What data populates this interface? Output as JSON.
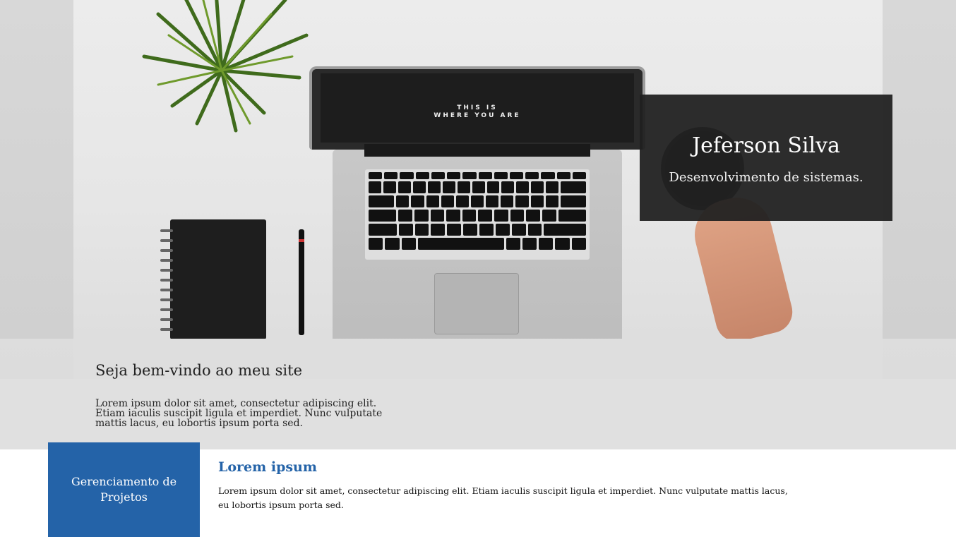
{
  "hero": {
    "name": "Jeferson Silva",
    "subtitle": "Desenvolvimento de sistemas.",
    "screen_line1": "THIS IS",
    "screen_line2": "WHERE YOU ARE"
  },
  "welcome": {
    "title": "Seja bem-vindo ao meu site",
    "text": "Lorem ipsum dolor sit amet, consectetur adipiscing elit. Etiam iaculis suscipit ligula et imperdiet. Nunc vulputate mattis lacus, eu lobortis ipsum porta sed."
  },
  "feature": {
    "box_label": "Gerenciamento de Projetos",
    "title": "Lorem ipsum",
    "text": "Lorem ipsum dolor sit amet, consectetur adipiscing elit. Etiam iaculis suscipit ligula et imperdiet. Nunc vulputate mattis lacus, eu lobortis ipsum porta sed."
  },
  "colors": {
    "accent": "#2463a8",
    "title_card_bg": "#202020",
    "welcome_bg": "#dddddd"
  }
}
